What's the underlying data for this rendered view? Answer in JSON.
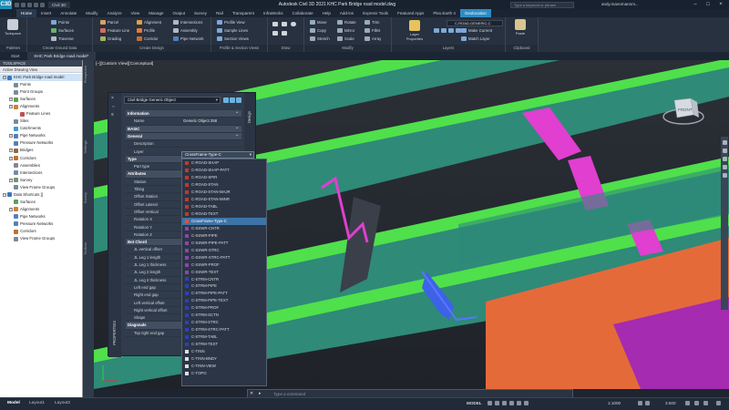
{
  "app": {
    "logo": "C3D",
    "name": "Civil 3D",
    "title": "Autodesk Civil 3D 2021   KHC Park Bridge road model.dwg",
    "search_placeholder": "Type a keyword or phrase",
    "user": "andy.mannmannm..."
  },
  "ribbon_tabs": [
    "Home",
    "Insert",
    "Annotate",
    "Modify",
    "Analyze",
    "View",
    "Manage",
    "Output",
    "Survey",
    "Rail",
    "Transparent",
    "InfraWorks",
    "Collaborate",
    "Help",
    "Add-ins",
    "Express Tools",
    "Featured Apps",
    "Plex.Earth 4",
    "Geolocation"
  ],
  "ribbon": {
    "toolspace": "Toolspace",
    "create_ground": {
      "items": [
        "Points",
        "Surfaces",
        "Traverse"
      ],
      "label": "Create Ground Data"
    },
    "create_design": {
      "items": [
        "Parcel",
        "Feature Line",
        "Grading",
        "Alignment",
        "Profile",
        "Corridor",
        "Intersections",
        "Assembly",
        "Pipe Network"
      ],
      "label": "Create Design"
    },
    "profile_section": {
      "items": [
        "Profile View",
        "Sample Lines",
        "Section Views"
      ],
      "label": "Profile & Section Views"
    },
    "draw": {
      "label": "Draw"
    },
    "modify": {
      "items": [
        "Move",
        "Copy",
        "Stretch",
        "Rotate",
        "Mirror",
        "Scale",
        "Trim",
        "Fillet",
        "Array"
      ],
      "label": "Modify"
    },
    "layers": {
      "big": "Layer Properties",
      "current": "C-ROAD-GENERIC-C",
      "items": [
        "Make Current",
        "Match Layer"
      ],
      "label": "Layers"
    },
    "clipboard": {
      "big": "Paste",
      "label": "Clipboard"
    },
    "palettes": "Palettes"
  },
  "doc_tabs": [
    "Start",
    "KHC Park Bridge road model*"
  ],
  "toolspace": {
    "title": "TOOLSPACE",
    "view": "Active Drawing View",
    "tree": [
      {
        "level": 0,
        "box": "−",
        "label": "KHC Park Bridge road model",
        "sel": true,
        "color": "#3b78c0"
      },
      {
        "level": 1,
        "box": "",
        "label": "Points",
        "color": "#7a8a9a"
      },
      {
        "level": 1,
        "box": "",
        "label": "Point Groups",
        "color": "#7a8a9a"
      },
      {
        "level": 1,
        "box": "+",
        "label": "Surfaces",
        "color": "#5aa05a"
      },
      {
        "level": 1,
        "box": "+",
        "label": "Alignments",
        "color": "#d08030"
      },
      {
        "level": 2,
        "box": "",
        "label": "Feature Lines",
        "color": "#c05050"
      },
      {
        "level": 1,
        "box": "",
        "label": "Sites",
        "color": "#7a8a9a"
      },
      {
        "level": 1,
        "box": "",
        "label": "Catchments",
        "color": "#3b9ed0"
      },
      {
        "level": 1,
        "box": "+",
        "label": "Pipe Networks",
        "color": "#5080c0"
      },
      {
        "level": 1,
        "box": "",
        "label": "Pressure Networks",
        "color": "#5080c0"
      },
      {
        "level": 1,
        "box": "+",
        "label": "Bridges",
        "color": "#8a6a4a"
      },
      {
        "level": 1,
        "box": "+",
        "label": "Corridors",
        "color": "#c07030"
      },
      {
        "level": 1,
        "box": "",
        "label": "Assemblies",
        "color": "#7a8a9a"
      },
      {
        "level": 1,
        "box": "",
        "label": "Intersections",
        "color": "#7a8a9a"
      },
      {
        "level": 1,
        "box": "+",
        "label": "Survey",
        "color": "#6a9a6a"
      },
      {
        "level": 1,
        "box": "",
        "label": "View Frame Groups",
        "color": "#7a8a9a"
      },
      {
        "level": 0,
        "box": "−",
        "label": "Data Shortcuts []",
        "color": "#3b78c0"
      },
      {
        "level": 1,
        "box": "",
        "label": "Surfaces",
        "color": "#5aa05a"
      },
      {
        "level": 1,
        "box": "+",
        "label": "Alignments",
        "color": "#d08030"
      },
      {
        "level": 1,
        "box": "",
        "label": "Pipe Networks",
        "color": "#5080c0"
      },
      {
        "level": 1,
        "box": "",
        "label": "Pressure Networks",
        "color": "#5080c0"
      },
      {
        "level": 1,
        "box": "",
        "label": "Corridors",
        "color": "#c07030"
      },
      {
        "level": 1,
        "box": "",
        "label": "View Frame Groups",
        "color": "#7a8a9a"
      }
    ],
    "side_tabs": [
      "Prospector",
      "Settings",
      "Survey",
      "Toolbox"
    ]
  },
  "viewport": {
    "label": "[−][Custom View][Conceptual]",
    "cube_face": "FRONT"
  },
  "properties": {
    "object": "Civil Bridge Generic Object",
    "strip_label": "PROPERTIES",
    "design_tab": "Design",
    "layer_value": "CrossFrame-Type-C",
    "rows": [
      {
        "t": "sec",
        "k": "Information"
      },
      {
        "k": "Name",
        "v": "Generic Object 258"
      },
      {
        "t": "sec",
        "k": "BASIC"
      },
      {
        "t": "sec",
        "k": "General"
      },
      {
        "k": "Description",
        "v": ""
      },
      {
        "k": "Layer",
        "v": ""
      },
      {
        "t": "sec",
        "k": "Type"
      },
      {
        "k": "Part type",
        "v": ""
      },
      {
        "t": "sec",
        "k": "Attributes"
      },
      {
        "k": "Station",
        "v": ""
      },
      {
        "k": "Tilting",
        "v": ""
      },
      {
        "k": "Offset Station",
        "v": ""
      },
      {
        "k": "Offset Lateral",
        "v": ""
      },
      {
        "k": "Offset Vertical",
        "v": ""
      },
      {
        "k": "Rotation X",
        "v": ""
      },
      {
        "k": "Rotation Y",
        "v": ""
      },
      {
        "k": "Rotation Z",
        "v": ""
      },
      {
        "t": "sec",
        "k": "Bot Chord"
      },
      {
        "k": "JL vertical offset",
        "v": ""
      },
      {
        "k": "JL Leg 1 length",
        "v": ""
      },
      {
        "k": "JL Leg 1 thickness",
        "v": ""
      },
      {
        "k": "JL Leg 2 length",
        "v": ""
      },
      {
        "k": "JL Leg 2 thickness",
        "v": ""
      },
      {
        "k": "Left end gap",
        "v": ""
      },
      {
        "k": "Right end gap",
        "v": ""
      },
      {
        "k": "Left vertical offset",
        "v": ""
      },
      {
        "k": "Right vertical offset",
        "v": ""
      },
      {
        "k": "Shape",
        "v": ""
      },
      {
        "t": "sec",
        "k": "Diagonals"
      },
      {
        "k": "Top right end gap",
        "v": ""
      }
    ],
    "layers": [
      {
        "n": "C-ROAD-SHAP",
        "c": "#c0392b"
      },
      {
        "n": "C-ROAD-SHAP-PATT",
        "c": "#c0392b"
      },
      {
        "n": "C-ROAD-SPIR",
        "c": "#c0392b"
      },
      {
        "n": "C-ROAD-STAN",
        "c": "#c0392b"
      },
      {
        "n": "C-ROAD-STAN-MAJR",
        "c": "#c0392b"
      },
      {
        "n": "C-ROAD-STAN-MINR",
        "c": "#c0392b"
      },
      {
        "n": "C-ROAD-TABL",
        "c": "#c0392b"
      },
      {
        "n": "C-ROAD-TEXT",
        "c": "#c0392b"
      },
      {
        "n": "CrossFrame-Type-C",
        "c": "#e74c3c",
        "sel": true
      },
      {
        "n": "C-SSWR-CNTR",
        "c": "#8e44ad"
      },
      {
        "n": "C-SSWR-PIPE",
        "c": "#8e44ad"
      },
      {
        "n": "C-SSWR-PIPE-PATT",
        "c": "#8e44ad"
      },
      {
        "n": "C-SSWR-STRC",
        "c": "#8e44ad"
      },
      {
        "n": "C-SSWR-STRC-PATT",
        "c": "#8e44ad"
      },
      {
        "n": "C-SSWR-PROF",
        "c": "#8e44ad"
      },
      {
        "n": "C-SSWR-TEXT",
        "c": "#8e44ad"
      },
      {
        "n": "C-STRM-CNTR",
        "c": "#2c3ec0"
      },
      {
        "n": "C-STRM-PIPE",
        "c": "#2c3ec0"
      },
      {
        "n": "C-STRM-PIPE-PATT",
        "c": "#2c3ec0"
      },
      {
        "n": "C-STRM-PIPE-TEXT",
        "c": "#2c3ec0"
      },
      {
        "n": "C-STRM-PROF",
        "c": "#2c3ec0"
      },
      {
        "n": "C-STRM-SCTN",
        "c": "#2c3ec0"
      },
      {
        "n": "C-STRM-STRC",
        "c": "#2c3ec0"
      },
      {
        "n": "C-STRM-STRC-PATT",
        "c": "#2c3ec0"
      },
      {
        "n": "C-STRM-TABL",
        "c": "#2c3ec0"
      },
      {
        "n": "C-STRM-TEXT",
        "c": "#2c3ec0"
      },
      {
        "n": "C-TINN",
        "c": "#e0e0e0"
      },
      {
        "n": "C-TINN-BNDY",
        "c": "#e0e0e0"
      },
      {
        "n": "C-TINN-VIEW",
        "c": "#e0e0e0"
      },
      {
        "n": "C-TOPO",
        "c": "#e0e0e0"
      }
    ]
  },
  "command": {
    "placeholder": "Type a command"
  },
  "layout_tabs": [
    "Model",
    "Layout1",
    "Layout2"
  ],
  "status": {
    "model": "MODEL",
    "scale": "1:1000",
    "elevation": "3.500"
  }
}
